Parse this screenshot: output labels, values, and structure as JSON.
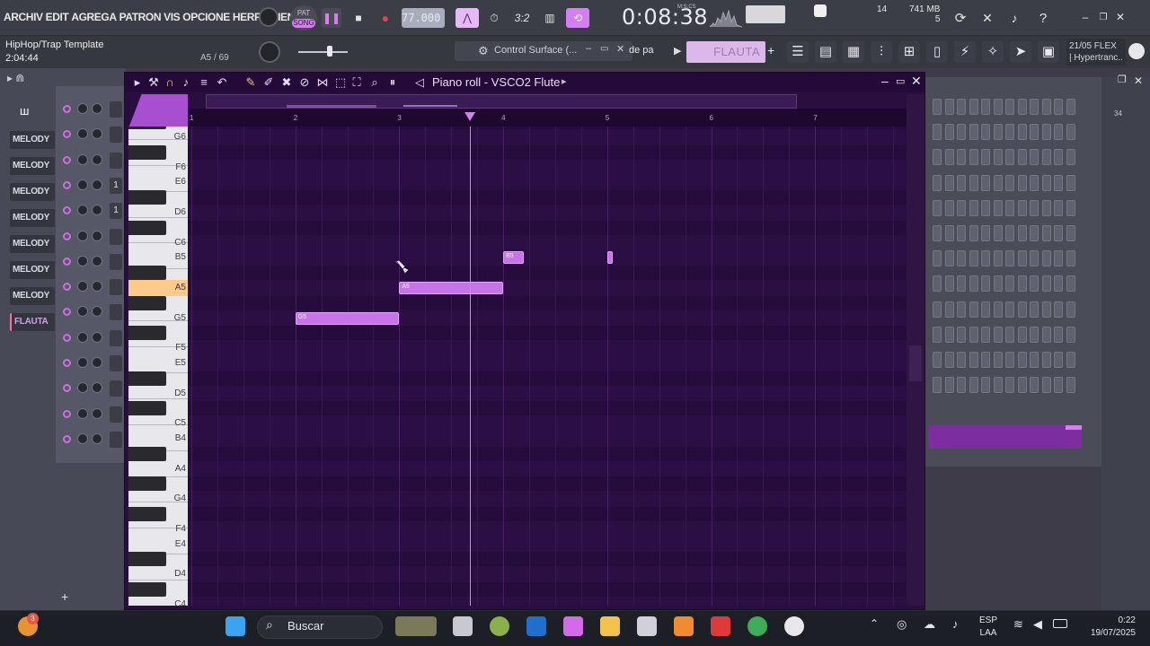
{
  "menu": [
    "ARCHIV",
    "EDIT",
    "AGREGA",
    "PATRON",
    "VIS",
    "OPCIONE",
    "HERRAMIENTA"
  ],
  "transport": {
    "pat_label": "PAT",
    "song_label": "SONG",
    "tempo": "77.000",
    "time": "0:08:38",
    "time_unit": "M:S:CS",
    "pattern_field": "3:2",
    "cpu": "14",
    "mem": "741 MB",
    "mem_sub": "5"
  },
  "project": {
    "template_name": "HipHop/Trap Template",
    "template_time": "2:04:44",
    "note_info": "A5 / 69",
    "control_surface": "Control Surface (...",
    "partial_label": "de pa",
    "hint": "FLAUTA",
    "flex_line1": "21/05  FLEX",
    "flex_line2": "| Hypertranc.."
  },
  "channel_rack": {
    "channels": [
      "MELODY",
      "MELODY",
      "MELODY",
      "MELODY",
      "MELODY",
      "MELODY",
      "MELODY",
      "FLAUTA"
    ],
    "mini_values": [
      "",
      "",
      "",
      "1",
      "1",
      "",
      "",
      "",
      "",
      "",
      "",
      "",
      "",
      ""
    ]
  },
  "piano_roll": {
    "title": "Piano roll - VSCO2 Flute",
    "bars": [
      "1",
      "2",
      "3",
      "4",
      "5",
      "6",
      "7"
    ],
    "keys": [
      "G6",
      "F6",
      "E6",
      "D6",
      "C6",
      "B5",
      "A5",
      "G5",
      "F5",
      "E5",
      "D5",
      "C5",
      "B4",
      "A4",
      "G4",
      "F4",
      "E4",
      "D4",
      "C4"
    ],
    "notes": [
      {
        "label": "G5",
        "pitch": "G5",
        "start": 2.0,
        "length": 1.0
      },
      {
        "label": "A5",
        "pitch": "A5",
        "start": 3.0,
        "length": 1.0
      },
      {
        "label": "B5",
        "pitch": "B5",
        "start": 4.0,
        "length": 0.2
      },
      {
        "label": "",
        "pitch": "B5",
        "start": 5.0,
        "length": 0.05
      }
    ],
    "playhead_bar": 3.68
  },
  "step_seq": {
    "step_number": "34"
  },
  "taskbar": {
    "search_label": "Buscar",
    "lang_line1": "ESP",
    "lang_line2": "LAA",
    "clock_time": "0:22",
    "clock_date": "19/07/2025",
    "badge": "3"
  },
  "colors": {
    "note": "#c873ea",
    "accent": "#d57df2",
    "roll_bg": "#2b0f44"
  }
}
